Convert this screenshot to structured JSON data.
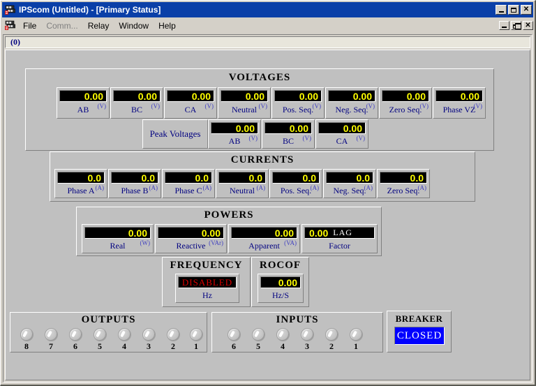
{
  "window": {
    "title": "IPScom  (Untitled) - [Primary Status]",
    "icon": "relay-icon",
    "minimize_label": "",
    "maximize_label": "",
    "close_label": "✕",
    "mdi_restore_label": "",
    "mdi_close_label": "✕"
  },
  "menu": {
    "icon": "relay-icon",
    "items": [
      {
        "label": "File",
        "disabled": false
      },
      {
        "label": "Comm...",
        "disabled": true
      },
      {
        "label": "Relay",
        "disabled": false
      },
      {
        "label": "Window",
        "disabled": false
      },
      {
        "label": "Help",
        "disabled": false
      }
    ]
  },
  "status": {
    "text": "(0)"
  },
  "colors": {
    "lcd_background": "#000000",
    "lcd_value": "#ffff00",
    "lcd_disabled_text": "#dd0000",
    "label_text": "#000080",
    "breaker_background": "#0000ff",
    "breaker_text": "#ffffff",
    "face": "#c0c0c0",
    "titlebar": "#0a3fa8"
  },
  "voltages": {
    "title": "VOLTAGES",
    "meters": [
      {
        "value": "0.00",
        "label": "AB",
        "unit": "(V)"
      },
      {
        "value": "0.00",
        "label": "BC",
        "unit": "(V)"
      },
      {
        "value": "0.00",
        "label": "CA",
        "unit": "(V)"
      },
      {
        "value": "0.00",
        "label": "Neutral",
        "unit": "(V)"
      },
      {
        "value": "0.00",
        "label": "Pos. Seq.",
        "unit": "(V)"
      },
      {
        "value": "0.00",
        "label": "Neg. Seq.",
        "unit": "(V)"
      },
      {
        "value": "0.00",
        "label": "Zero Seq.",
        "unit": "(V)"
      },
      {
        "value": "0.00",
        "label": "Phase VZ",
        "unit": "(V)"
      }
    ],
    "peak_caption": "Peak Voltages",
    "peak_meters": [
      {
        "value": "0.00",
        "label": "AB",
        "unit": "(V)"
      },
      {
        "value": "0.00",
        "label": "BC",
        "unit": "(V)"
      },
      {
        "value": "0.00",
        "label": "CA",
        "unit": "(V)"
      }
    ]
  },
  "currents": {
    "title": "CURRENTS",
    "meters": [
      {
        "value": "0.0",
        "label": "Phase A",
        "unit": "(A)"
      },
      {
        "value": "0.0",
        "label": "Phase B",
        "unit": "(A)"
      },
      {
        "value": "0.0",
        "label": "Phase C",
        "unit": "(A)"
      },
      {
        "value": "0.0",
        "label": "Neutral",
        "unit": "(A)"
      },
      {
        "value": "0.0",
        "label": "Pos. Seq.",
        "unit": "(A)"
      },
      {
        "value": "0.0",
        "label": "Neg. Seq.",
        "unit": "(A)"
      },
      {
        "value": "0.0",
        "label": "Zero Seq.",
        "unit": "(A)"
      }
    ]
  },
  "powers": {
    "title": "POWERS",
    "meters": [
      {
        "value": "0.00",
        "label": "Real",
        "unit": "(W)",
        "suffix": ""
      },
      {
        "value": "0.00",
        "label": "Reactive",
        "unit": "(VAr)",
        "suffix": ""
      },
      {
        "value": "0.00",
        "label": "Apparent",
        "unit": "(VA)",
        "suffix": ""
      },
      {
        "value": "0.00",
        "label": "Factor",
        "unit": "",
        "suffix": "LAG"
      }
    ]
  },
  "frequency": {
    "title": "FREQUENCY",
    "value": "DISABLED",
    "label": "Hz",
    "disabled": true
  },
  "rocof": {
    "title": "ROCOF",
    "value": "0.00",
    "label": "Hz/S",
    "disabled": false
  },
  "outputs": {
    "title": "OUTPUTS",
    "leds": [
      "8",
      "7",
      "6",
      "5",
      "4",
      "3",
      "2",
      "1"
    ]
  },
  "inputs": {
    "title": "INPUTS",
    "leds": [
      "6",
      "5",
      "4",
      "3",
      "2",
      "1"
    ]
  },
  "breaker": {
    "title": "BREAKER",
    "state": "CLOSED"
  }
}
